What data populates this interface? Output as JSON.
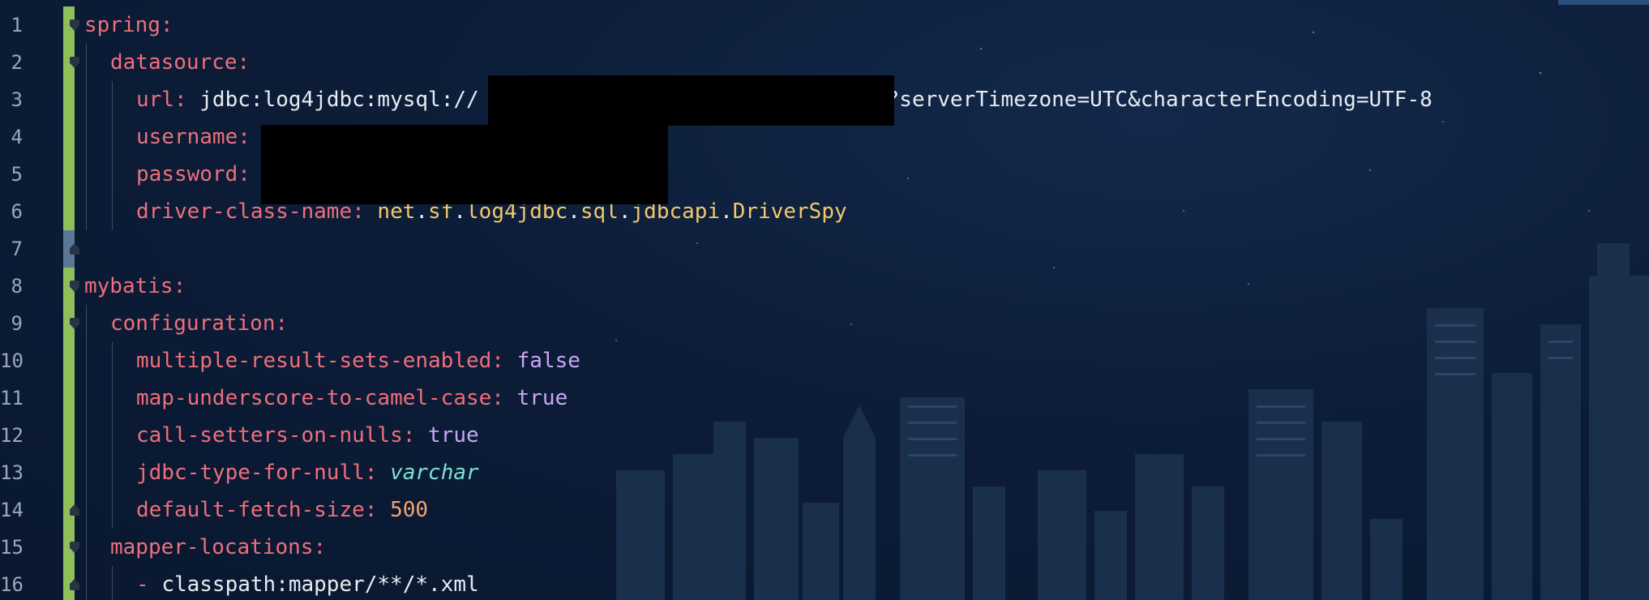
{
  "editor": {
    "line_numbers": [
      "1",
      "2",
      "3",
      "4",
      "5",
      "6",
      "7",
      "8",
      "9",
      "10",
      "11",
      "12",
      "13",
      "14",
      "15",
      "16"
    ],
    "lines": {
      "l1": {
        "key": "spring",
        "colon": ":"
      },
      "l2": {
        "key": "datasource",
        "colon": ":"
      },
      "l3": {
        "key": "url",
        "colon": ": ",
        "value_prefix": "jdbc:log4jdbc:mysql://",
        "value_suffix": "?serverTimezone=UTC&characterEncoding=UTF-8"
      },
      "l4": {
        "key": "username",
        "colon": ":"
      },
      "l5": {
        "key": "password",
        "colon": ":"
      },
      "l6": {
        "key": "driver-class-name",
        "colon": ": ",
        "v1": "net",
        "d1": ".",
        "v2": "sf",
        "d2": ".",
        "v3": "log4jdbc",
        "d3": ".",
        "v4": "sql",
        "d4": ".",
        "v5": "jdbcapi",
        "d5": ".",
        "v6": "DriverSpy"
      },
      "l8": {
        "key": "mybatis",
        "colon": ":"
      },
      "l9": {
        "key": "configuration",
        "colon": ":"
      },
      "l10": {
        "key": "multiple-result-sets-enabled",
        "colon": ": ",
        "value": "false"
      },
      "l11": {
        "key": "map-underscore-to-camel-case",
        "colon": ": ",
        "value": "true"
      },
      "l12": {
        "key": "call-setters-on-nulls",
        "colon": ": ",
        "value": "true"
      },
      "l13": {
        "key": "jdbc-type-for-null",
        "colon": ": ",
        "value": "varchar"
      },
      "l14": {
        "key": "default-fetch-size",
        "colon": ": ",
        "value": "500"
      },
      "l15": {
        "key": "mapper-locations",
        "colon": ":"
      },
      "l16": {
        "dash": "- ",
        "value": "classpath:mapper/**/*.xml"
      }
    }
  },
  "colors": {
    "key": "#ee6f7c",
    "string": "#e8ecf2",
    "class": "#f3c86b",
    "boolean": "#c8a6f5",
    "number": "#f7a16a",
    "keyword_italic": "#7ee0d2",
    "change_bar": "#8fbf5a"
  },
  "icons": [
    "fold-open-icon",
    "fold-close-icon"
  ]
}
